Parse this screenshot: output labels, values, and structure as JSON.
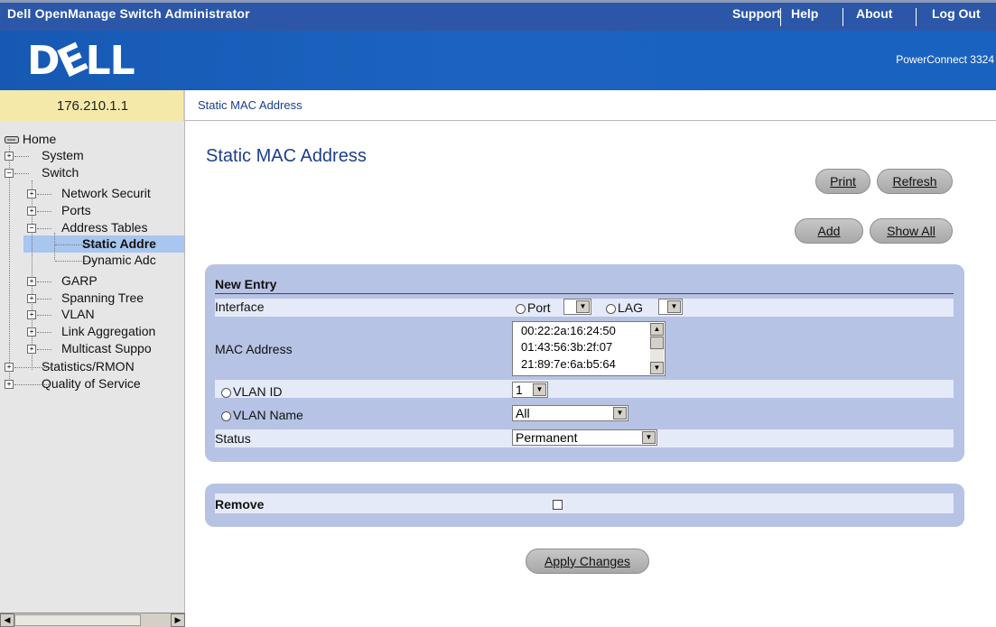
{
  "header": {
    "app_title": "Dell OpenManage Switch Administrator",
    "links": [
      "Support",
      "Help",
      "About",
      "Log Out"
    ],
    "logo_text": "DELL",
    "product": "PowerConnect 3324"
  },
  "device_ip": "176.210.1.1",
  "breadcrumb": "Static MAC Address",
  "tree": {
    "items": [
      {
        "label": "Home"
      },
      {
        "label": "System"
      },
      {
        "label": "Switch"
      },
      {
        "label": "Network Securit"
      },
      {
        "label": "Ports"
      },
      {
        "label": "Address Tables"
      },
      {
        "label": "Static Addre"
      },
      {
        "label": "Dynamic Adc"
      },
      {
        "label": "GARP"
      },
      {
        "label": "Spanning Tree"
      },
      {
        "label": "VLAN"
      },
      {
        "label": "Link Aggregation"
      },
      {
        "label": "Multicast Suppo"
      },
      {
        "label": "Statistics/RMON"
      },
      {
        "label": "Quality of Service"
      }
    ],
    "expand_symbols": {
      "plus": "+",
      "minus": "−"
    }
  },
  "main": {
    "title": "Static MAC Address",
    "buttons": {
      "print": "Print",
      "refresh": "Refresh",
      "add": "Add",
      "show_all": "Show All",
      "apply": "Apply Changes"
    },
    "new_entry": {
      "header": "New Entry",
      "interface_label": "Interface",
      "port_label": "Port",
      "lag_label": "LAG",
      "mac_label": "MAC Address",
      "mac_options": [
        "00:22:2a:16:24:50",
        "01:43:56:3b:2f:07",
        "21:89:7e:6a:b5:64"
      ],
      "vlan_id_label": "VLAN ID",
      "vlan_id_value": "1",
      "vlan_name_label": "VLAN Name",
      "vlan_name_value": "All",
      "status_label": "Status",
      "status_value": "Permanent"
    },
    "remove": {
      "label": "Remove",
      "checked": false
    }
  },
  "colors": {
    "topbar": "#2c57a8",
    "banner": "#1b63bf",
    "ip_background": "#f4e9a9",
    "panel": "#b7c3e4",
    "selected_tree_item": "#a8c6ef"
  }
}
